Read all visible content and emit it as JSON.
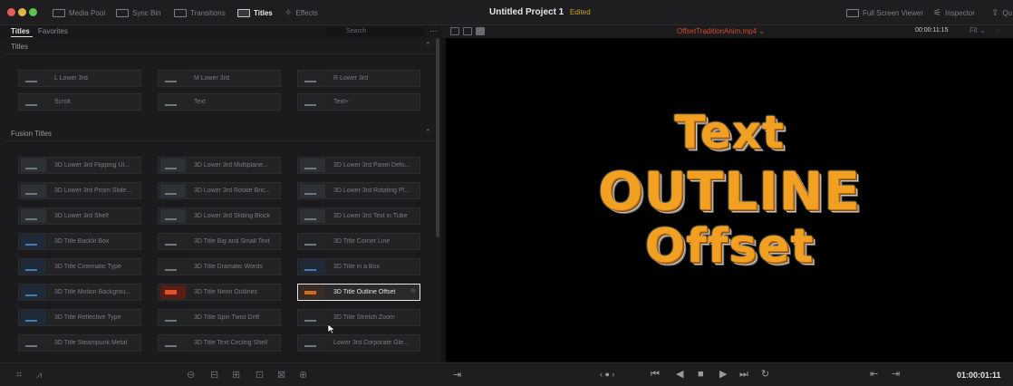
{
  "colors": {
    "accent_orange": "#f2a021",
    "edited": "#c9a227",
    "clip_name": "#d14a2a",
    "panel": "#1b1b1d",
    "viewer": "#000000"
  },
  "toolbar": {
    "buttons": [
      {
        "label": "Media Pool",
        "icon": "media-pool-icon"
      },
      {
        "label": "Sync Bin",
        "icon": "sync-bin-icon"
      },
      {
        "label": "Transitions",
        "icon": "transitions-icon"
      },
      {
        "label": "Titles",
        "icon": "titles-icon",
        "active": true
      },
      {
        "label": "Effects",
        "icon": "effects-icon"
      }
    ],
    "project_title": "Untitled Project 1",
    "status": "Edited",
    "right": [
      {
        "label": "Full Screen Viewer",
        "icon": "full-screen-icon"
      },
      {
        "label": "Inspector",
        "icon": "inspector-icon"
      },
      {
        "label": "Qu",
        "icon": "quick-export-icon"
      }
    ]
  },
  "panel": {
    "tabs": [
      "Titles",
      "Favorites"
    ],
    "search_placeholder": "Search",
    "more_icon": "more-icon",
    "sections": [
      {
        "label": "Titles",
        "items": [
          "L Lower 3rd",
          "M Lower 3rd",
          "R Lower 3rd",
          "Scroll",
          "Text",
          "Text+"
        ]
      },
      {
        "label": "Fusion Titles",
        "items": [
          "3D Lower 3rd Flipping Ul...",
          "3D Lower 3rd Multiplane...",
          "3D Lower 3rd Panel Defo...",
          "3D Lower 3rd Prism Slide...",
          "3D Lower 3rd Rotate Bric...",
          "3D Lower 3rd Rotating Pl...",
          "3D Lower 3rd Shelf",
          "3D Lower 3rd Sliding Block",
          "3D Lower 3rd Text in Tube",
          "3D Title Backlit Box",
          "3D Title Big and Small Text",
          "3D Title Corner Line",
          "3D Title Cinematic Type",
          "3D Title Dramatic Words",
          "3D Title in a Box",
          "3D Title Motion Backgrou...",
          "3D Title Neon Outlines",
          "3D Title Outline Offset",
          "3D Title Reflective Type",
          "3D Title Spin Twist Drift",
          "3D Title Stretch Zoom",
          "3D Title Steampunk Metal",
          "3D Title Text Circling Shell",
          "Lower 3rd Corporate Gle..."
        ]
      }
    ],
    "selected": "3D Title Outline Offset"
  },
  "viewer": {
    "clip_name": "OffsetTraditionAnim.mp4",
    "timecode_top": "00:00:11:15",
    "zoom": "Fit",
    "overlay_lines": [
      "Text",
      "OUTLINE",
      "Offset"
    ]
  },
  "bottombar": {
    "timecode": "01:00:01:11"
  }
}
